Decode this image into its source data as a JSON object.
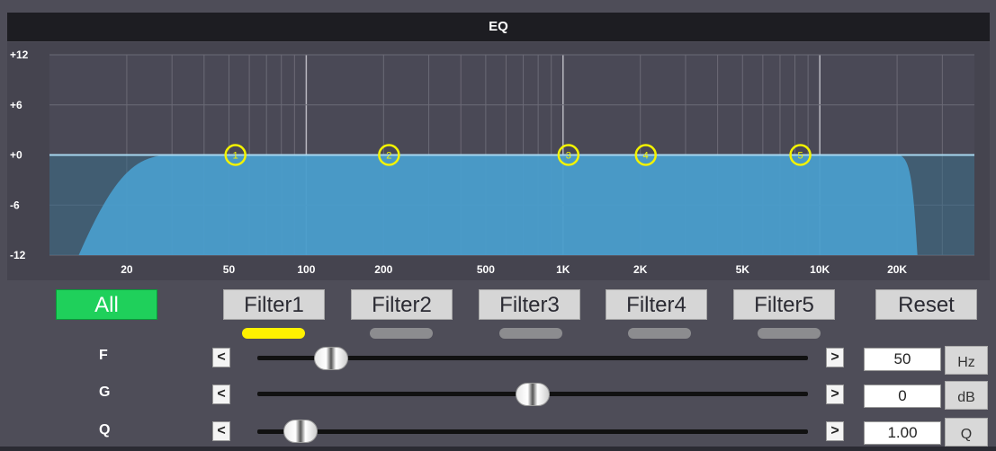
{
  "window": {
    "title": "EQ"
  },
  "graph": {
    "y_ticks": [
      "+12",
      "+6",
      "+0",
      "-6",
      "-12"
    ],
    "x_ticks": [
      "20",
      "50",
      "100",
      "200",
      "500",
      "1K",
      "2K",
      "5K",
      "10K",
      "20K"
    ],
    "filter_markers": [
      "1",
      "2",
      "3",
      "4",
      "5"
    ],
    "curve_color": "#4aa0cf",
    "line_color": "#a8d8f0",
    "marker_color": "#f3f300"
  },
  "buttons": {
    "all": "All",
    "filters": [
      "Filter1",
      "Filter2",
      "Filter3",
      "Filter4",
      "Filter5"
    ],
    "reset": "Reset",
    "selected_filter": "Filter1",
    "active_color": "#1fd05b"
  },
  "controls": {
    "f": {
      "label": "F",
      "value": "50",
      "unit": "Hz",
      "position": 0.11
    },
    "g": {
      "label": "G",
      "value": "0",
      "unit": "dB",
      "position": 0.5
    },
    "q": {
      "label": "Q",
      "value": "1.00",
      "unit": "Q",
      "position": 0.05
    },
    "left_arrow": "<",
    "right_arrow": ">"
  }
}
